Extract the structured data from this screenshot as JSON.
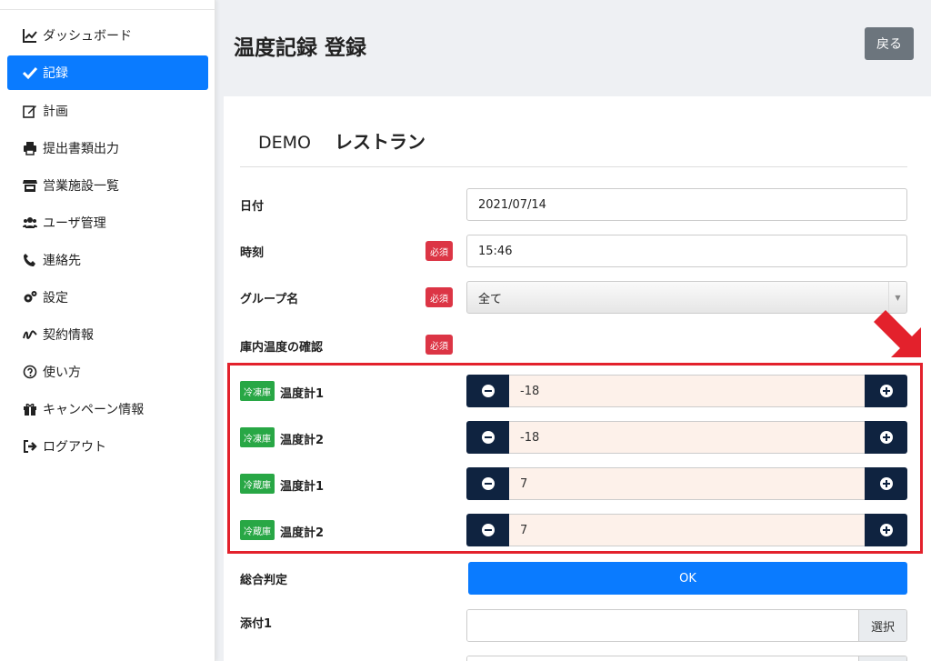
{
  "sidebar": {
    "items": [
      {
        "label": "ダッシュボード",
        "icon": "chart-line-icon"
      },
      {
        "label": "記録",
        "icon": "check-icon",
        "active": true
      },
      {
        "label": "計画",
        "icon": "edit-icon"
      },
      {
        "label": "提出書類出力",
        "icon": "print-icon"
      },
      {
        "label": "営業施設一覧",
        "icon": "store-icon"
      },
      {
        "label": "ユーザ管理",
        "icon": "users-icon"
      },
      {
        "label": "連絡先",
        "icon": "phone-icon"
      },
      {
        "label": "設定",
        "icon": "cogs-icon"
      },
      {
        "label": "契約情報",
        "icon": "signature-icon"
      },
      {
        "label": "使い方",
        "icon": "question-circle-icon"
      },
      {
        "label": "キャンペーン情報",
        "icon": "gift-icon"
      },
      {
        "label": "ログアウト",
        "icon": "sign-out-icon"
      }
    ]
  },
  "header": {
    "title": "温度記録 登録",
    "back_label": "戻る"
  },
  "store": {
    "prefix": "DEMO",
    "name": "レストラン"
  },
  "form": {
    "required_label": "必須",
    "date": {
      "label": "日付",
      "value": "2021/07/14"
    },
    "time": {
      "label": "時刻",
      "value": "15:46"
    },
    "group": {
      "label": "グループ名",
      "value": "全て"
    },
    "temp_check": {
      "label": "庫内温度の確認"
    },
    "thermometers": [
      {
        "badge": "冷凍庫",
        "label": "温度計1",
        "value": "-18"
      },
      {
        "badge": "冷凍庫",
        "label": "温度計2",
        "value": "-18"
      },
      {
        "badge": "冷蔵庫",
        "label": "温度計1",
        "value": "7"
      },
      {
        "badge": "冷蔵庫",
        "label": "温度計2",
        "value": "7"
      }
    ],
    "judgement": {
      "label": "総合判定",
      "value": "OK"
    },
    "attachment1": {
      "label": "添付1",
      "button": "選択"
    }
  },
  "colors": {
    "accent": "#0a7bff",
    "required": "#dc3545",
    "badge": "#28a745",
    "stepper": "#0f2340",
    "highlight": "#e3212c"
  }
}
